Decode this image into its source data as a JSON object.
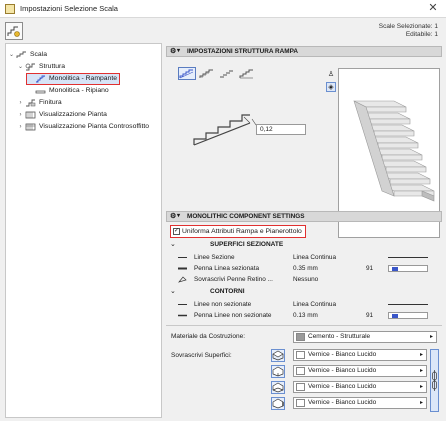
{
  "window": {
    "title": "Impostazioni Selezione Scala",
    "close": "✕"
  },
  "selection_info": {
    "selected": "Scale Selezionate: 1",
    "editable": "Editabile: 1"
  },
  "tree": {
    "items": [
      {
        "label": "Scala",
        "level": 0,
        "expanded": true,
        "icon": "stair-icon"
      },
      {
        "label": "Struttura",
        "level": 1,
        "expanded": true,
        "icon": "structure-icon"
      },
      {
        "label": "Monolitica - Rampante",
        "level": 2,
        "selected": true,
        "icon": "flight-icon"
      },
      {
        "label": "Monolitica - Ripiano",
        "level": 2,
        "icon": "landing-icon"
      },
      {
        "label": "Finitura",
        "level": 1,
        "expanded": false,
        "icon": "finish-icon"
      },
      {
        "label": "Visualizzazione Pianta",
        "level": 1,
        "expanded": false,
        "icon": "plan-icon"
      },
      {
        "label": "Visualizzazione Pianta Controsoffitto",
        "level": 1,
        "expanded": false,
        "icon": "ceiling-plan-icon"
      }
    ]
  },
  "panel": {
    "structure_header": "IMPOSTAZIONI STRUTTURA RAMPA",
    "thickness_value": "0,12",
    "component_header": "MONOLITHIC COMPONENT SETTINGS",
    "uniform_checkbox": {
      "label": "Uniforma Attributi Rampa e Pianerottolo",
      "checked": true
    },
    "cut_section": {
      "title": "SUPERFICI SEZIONATE",
      "rows": [
        {
          "label": "Linee Sezione",
          "value": "Linea Continua",
          "num": "",
          "kind": "line"
        },
        {
          "label": "Penna Linea sezionata",
          "value": "0.35 mm",
          "num": "91",
          "kind": "pen"
        },
        {
          "label": "Sovrascrivi Penne Retino ...",
          "value": "Nessuno",
          "num": "",
          "kind": "none"
        }
      ]
    },
    "outline_section": {
      "title": "CONTORNI",
      "rows": [
        {
          "label": "Linee non sezionate",
          "value": "Linea Continua",
          "num": "",
          "kind": "line"
        },
        {
          "label": "Penna Linee non sezionate",
          "value": "0.13 mm",
          "num": "91",
          "kind": "pen"
        }
      ]
    },
    "material_label": "Materiale da Costruzione:",
    "material_value": "Cemento - Strutturale",
    "override_label": "Sovrascrivi Superfici:",
    "surfaces": [
      "Vernice - Bianco Lucido",
      "Vernice - Bianco Lucido",
      "Vernice - Bianco Lucido",
      "Vernice - Bianco Lucido"
    ]
  },
  "colors": {
    "selection_outline": "#e03030",
    "accent_blue": "#3a56c8",
    "panel_header": "#d8d8d8"
  }
}
